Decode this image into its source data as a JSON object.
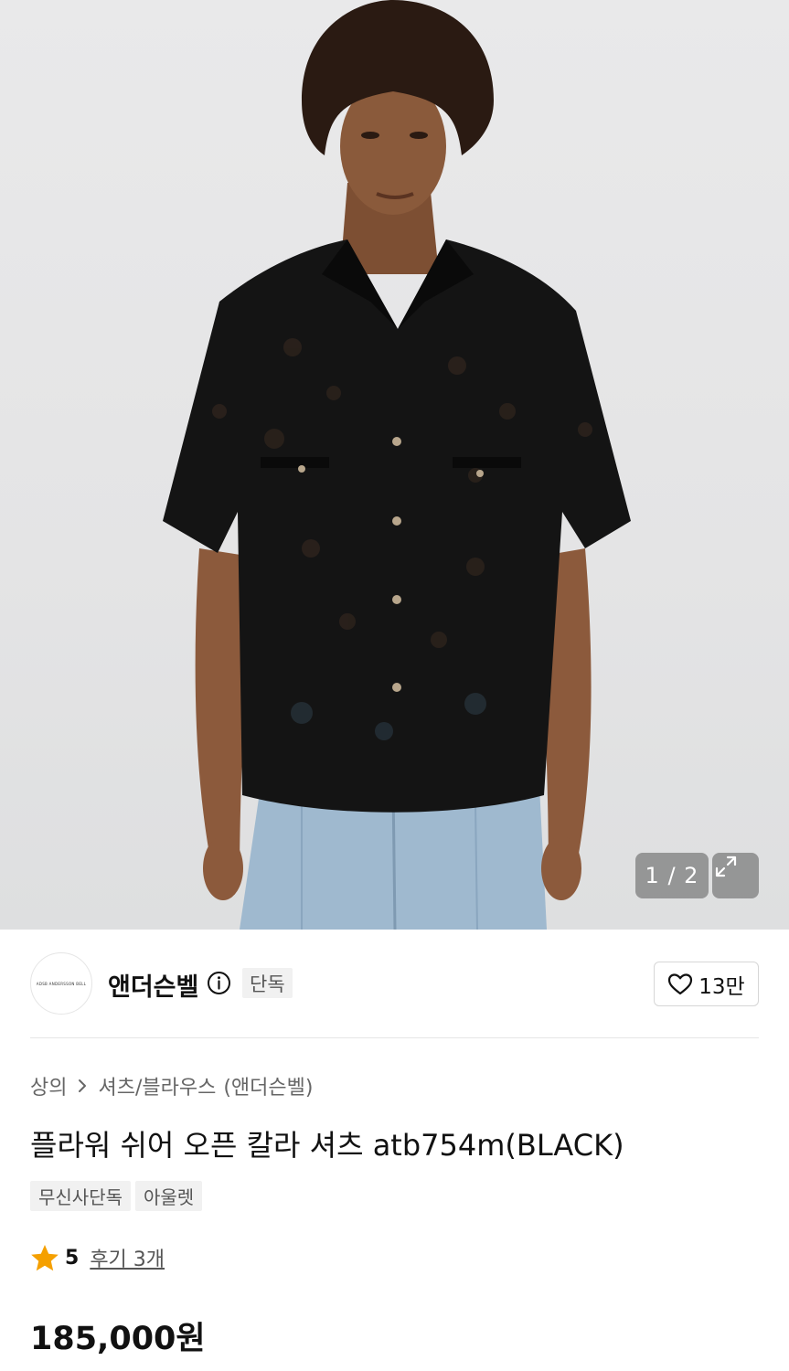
{
  "gallery": {
    "counter": "1 / 2"
  },
  "brand": {
    "logo_text": "ADSB ANDERSSON BELL",
    "name": "앤더슨벨",
    "exclusive_label": "단독",
    "like_count": "13만"
  },
  "breadcrumb": {
    "category": "상의",
    "subcategory": "셔츠/블라우스",
    "brand": "(앤더슨벨)"
  },
  "product": {
    "title": "플라워 쉬어 오픈 칼라 셔츠 atb754m(BLACK)",
    "tags": [
      "무신사단독",
      "아울렛"
    ],
    "rating": "5",
    "reviews": "후기 3개",
    "price": "185,000원"
  },
  "colors": {
    "star": "#f5a000",
    "text": "#111111",
    "muted": "#666666",
    "tag_bg": "#f1f1f1"
  },
  "icons": [
    "expand-icon",
    "info-icon",
    "heart-icon",
    "chevron-right-icon",
    "star-icon"
  ]
}
